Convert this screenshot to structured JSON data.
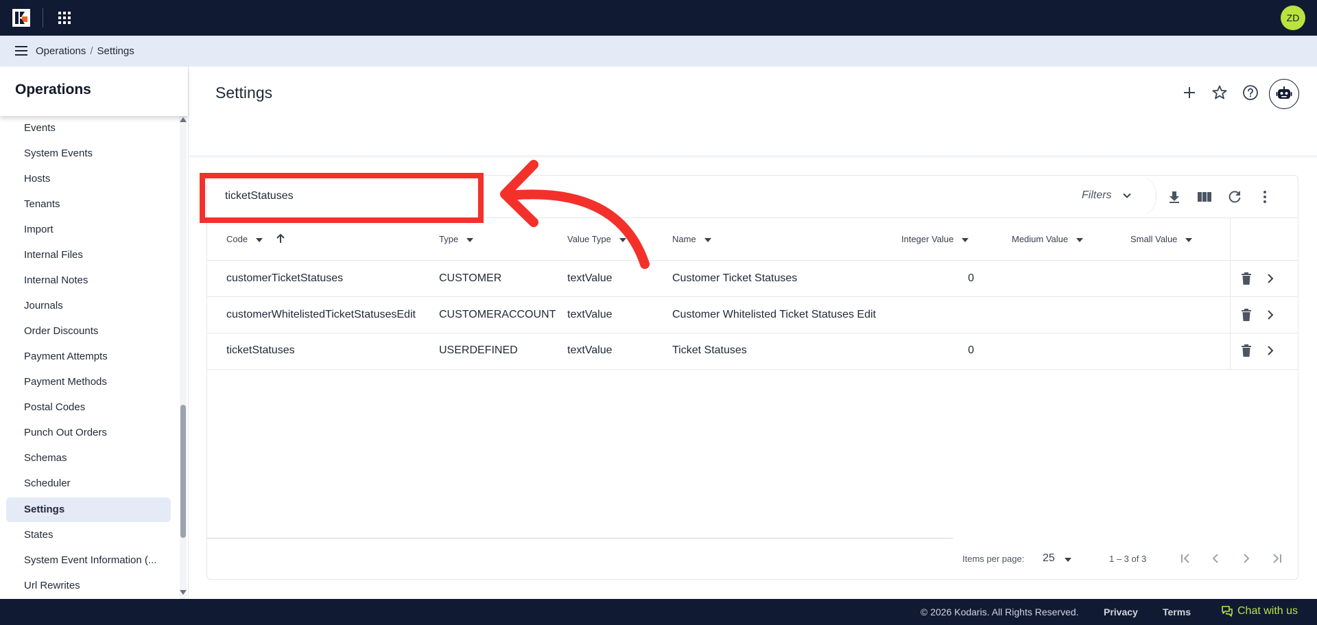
{
  "topbar": {
    "avatar_initials": "ZD"
  },
  "breadcrumb": {
    "parent": "Operations",
    "separator": "/",
    "current": "Settings"
  },
  "sidebar": {
    "title": "Operations",
    "items": [
      {
        "label": "Events",
        "active": false
      },
      {
        "label": "System Events",
        "active": false
      },
      {
        "label": "Hosts",
        "active": false
      },
      {
        "label": "Tenants",
        "active": false
      },
      {
        "label": "Import",
        "active": false
      },
      {
        "label": "Internal Files",
        "active": false
      },
      {
        "label": "Internal Notes",
        "active": false
      },
      {
        "label": "Journals",
        "active": false
      },
      {
        "label": "Order Discounts",
        "active": false
      },
      {
        "label": "Payment Attempts",
        "active": false
      },
      {
        "label": "Payment Methods",
        "active": false
      },
      {
        "label": "Postal Codes",
        "active": false
      },
      {
        "label": "Punch Out Orders",
        "active": false
      },
      {
        "label": "Schemas",
        "active": false
      },
      {
        "label": "Scheduler",
        "active": false
      },
      {
        "label": "Settings",
        "active": true
      },
      {
        "label": "States",
        "active": false
      },
      {
        "label": "System Event Information (...",
        "active": false
      },
      {
        "label": "Url Rewrites",
        "active": false
      }
    ]
  },
  "page": {
    "title": "Settings"
  },
  "toolbar": {
    "search_value": "ticketStatuses",
    "filters_label": "Filters"
  },
  "table": {
    "columns": [
      "Code",
      "Type",
      "Value Type",
      "Name",
      "Integer Value",
      "Medium Value",
      "Small Value"
    ],
    "rows": [
      {
        "code": "customerTicketStatuses",
        "type": "CUSTOMER",
        "value_type": "textValue",
        "name": "Customer Ticket Statuses",
        "integer_value": "0",
        "medium_value": "",
        "small_value": ""
      },
      {
        "code": "customerWhitelistedTicketStatusesEdit",
        "type": "CUSTOMERACCOUNT",
        "value_type": "textValue",
        "name": "Customer Whitelisted Ticket Statuses Edit",
        "integer_value": "",
        "medium_value": "",
        "small_value": ""
      },
      {
        "code": "ticketStatuses",
        "type": "USERDEFINED",
        "value_type": "textValue",
        "name": "Ticket Statuses",
        "integer_value": "0",
        "medium_value": "",
        "small_value": ""
      }
    ]
  },
  "pagination": {
    "items_per_page_label": "Items per page:",
    "page_size": "25",
    "range": "1 – 3 of 3"
  },
  "footer": {
    "copyright": "© 2026 Kodaris. All Rights Reserved.",
    "privacy": "Privacy",
    "terms": "Terms",
    "chat": "Chat with us"
  },
  "colors": {
    "topbar": "#111a33",
    "accent": "#b9e33f",
    "annotation": "#f4302b",
    "active_bg": "#e5ebf6"
  },
  "icons": [
    "kodaris-logo-icon",
    "apps-grid-icon",
    "menu-icon",
    "plus-icon",
    "star-icon",
    "help-icon",
    "robot-icon",
    "chevron-down-icon",
    "download-icon",
    "columns-icon",
    "refresh-icon",
    "more-vert-icon",
    "sort-desc-icon",
    "arrow-up-icon",
    "trash-icon",
    "chevron-right-icon",
    "first-page-icon",
    "prev-page-icon",
    "next-page-icon",
    "last-page-icon",
    "chat-icon"
  ]
}
